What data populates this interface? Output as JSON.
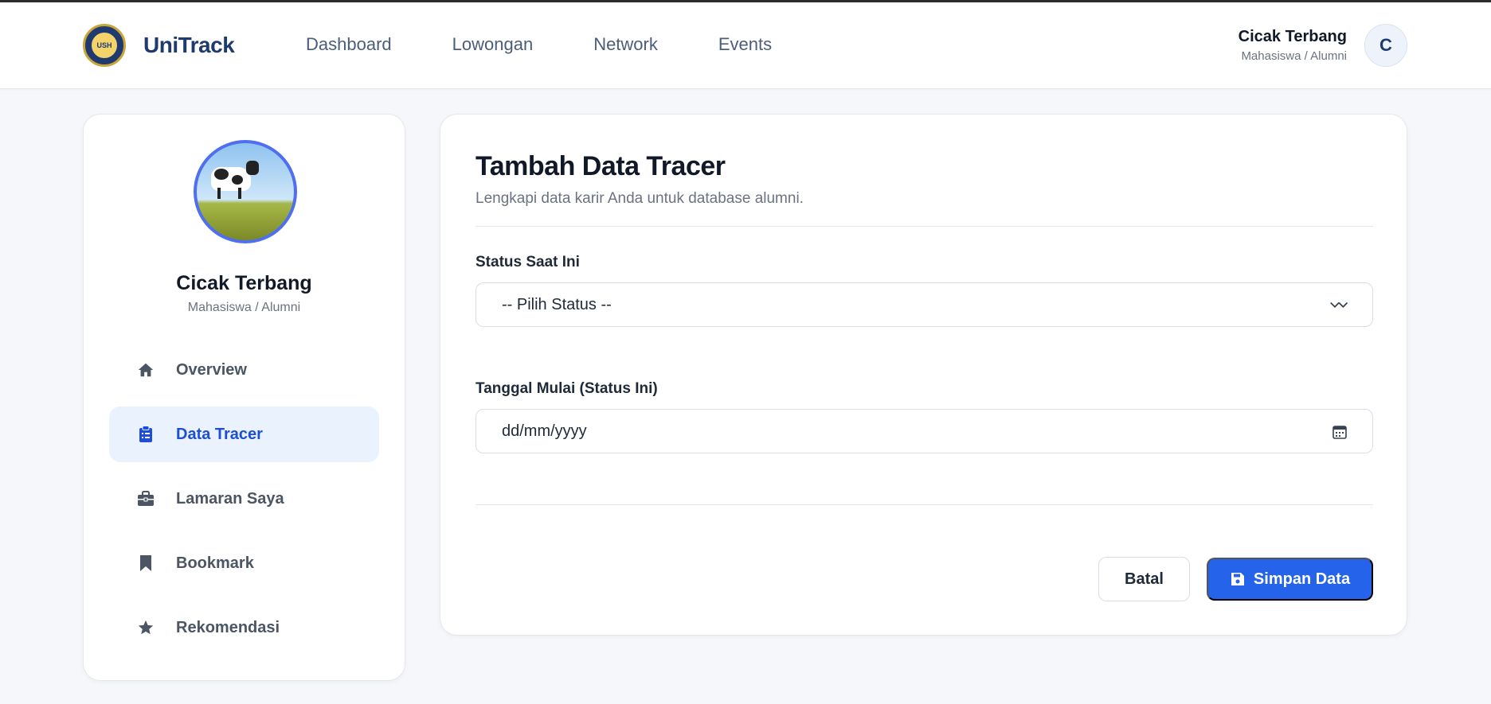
{
  "navbar": {
    "logo_text": "USH",
    "brand": "UniTrack",
    "links": [
      {
        "label": "Dashboard"
      },
      {
        "label": "Lowongan"
      },
      {
        "label": "Network"
      },
      {
        "label": "Events"
      }
    ],
    "user": {
      "name": "Cicak Terbang",
      "role": "Mahasiswa / Alumni",
      "initial": "C"
    }
  },
  "sidebar": {
    "profile": {
      "name": "Cicak Terbang",
      "role": "Mahasiswa / Alumni"
    },
    "items": [
      {
        "label": "Overview",
        "icon": "home-icon",
        "active": false
      },
      {
        "label": "Data Tracer",
        "icon": "clipboard-icon",
        "active": true
      },
      {
        "label": "Lamaran Saya",
        "icon": "briefcase-icon",
        "active": false
      },
      {
        "label": "Bookmark",
        "icon": "bookmark-icon",
        "active": false
      },
      {
        "label": "Rekomendasi",
        "icon": "star-icon",
        "active": false
      }
    ]
  },
  "main": {
    "title": "Tambah Data Tracer",
    "subtitle": "Lengkapi data karir Anda untuk database alumni.",
    "status": {
      "label": "Status Saat Ini",
      "value": "-- Pilih Status --"
    },
    "start_date": {
      "label": "Tanggal Mulai (Status Ini)",
      "value": "dd/mm/yyyy"
    },
    "cancel_label": "Batal",
    "save_label": "Simpan Data"
  },
  "colors": {
    "primary": "#2563eb",
    "brand": "#1e3a6e",
    "active_bg": "#eaf2fe",
    "page_bg": "#f5f7fa"
  }
}
